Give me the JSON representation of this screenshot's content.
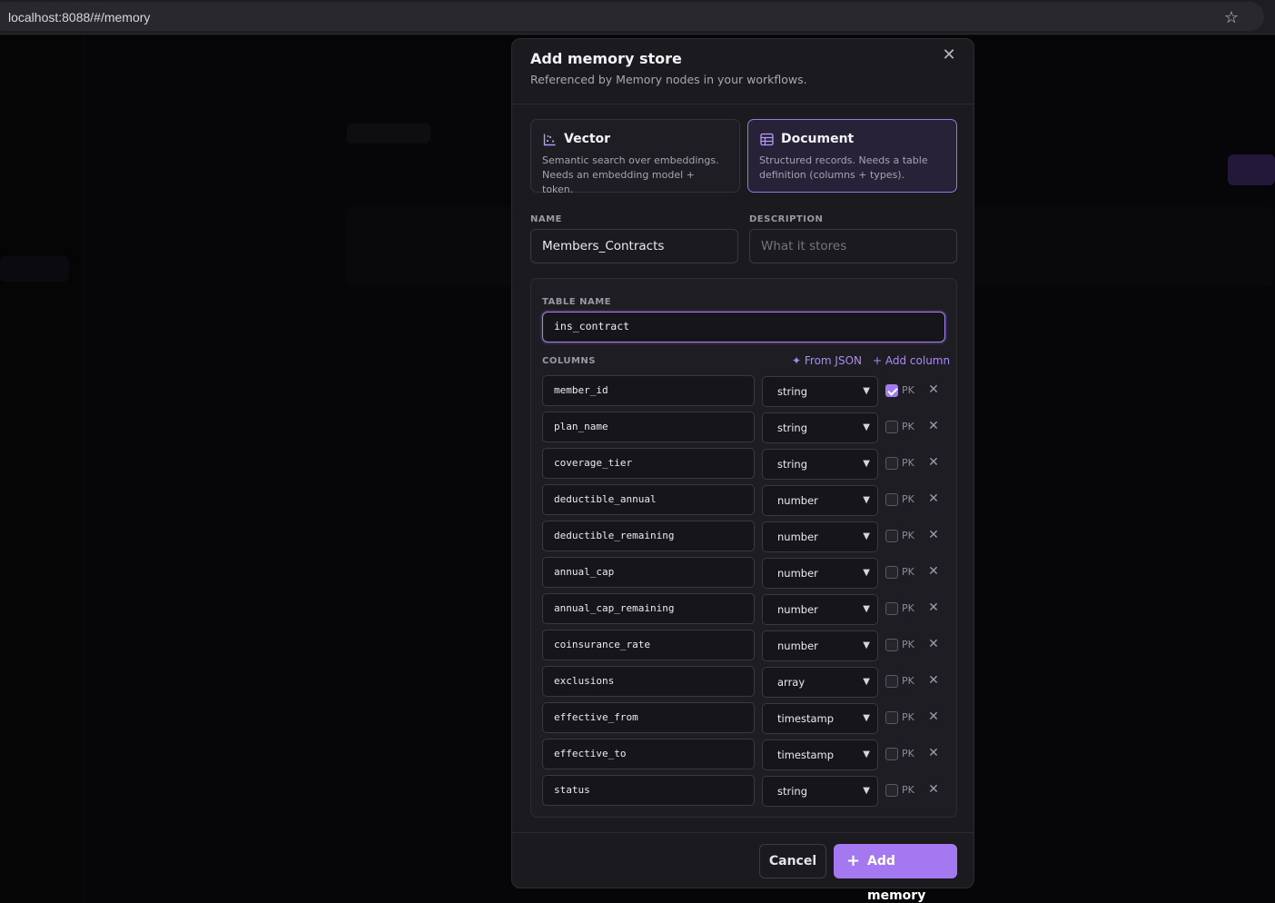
{
  "browser": {
    "url": "localhost:8088/#/memory"
  },
  "modal": {
    "title": "Add memory store",
    "subtitle": "Referenced by Memory nodes in your workflows.",
    "types": [
      {
        "title": "Vector",
        "desc": "Semantic search over embeddings. Needs an embedding model + token.",
        "selected": false,
        "icon": "scatter-chart-icon"
      },
      {
        "title": "Document",
        "desc": "Structured records. Needs a table definition (columns + types).",
        "selected": true,
        "icon": "table-icon"
      }
    ],
    "name_label": "NAME",
    "name_value": "Members_Contracts",
    "description_label": "DESCRIPTION",
    "description_placeholder": "What it stores",
    "table_name_label": "TABLE NAME",
    "table_name_value": "ins_contract",
    "columns_label": "COLUMNS",
    "from_json_label": "✦ From JSON",
    "add_column_label": "+ Add column",
    "pk_label": "PK",
    "columns": [
      {
        "name": "member_id",
        "type": "string",
        "pk": true
      },
      {
        "name": "plan_name",
        "type": "string",
        "pk": false
      },
      {
        "name": "coverage_tier",
        "type": "string",
        "pk": false
      },
      {
        "name": "deductible_annual",
        "type": "number",
        "pk": false
      },
      {
        "name": "deductible_remaining",
        "type": "number",
        "pk": false
      },
      {
        "name": "annual_cap",
        "type": "number",
        "pk": false
      },
      {
        "name": "annual_cap_remaining",
        "type": "number",
        "pk": false
      },
      {
        "name": "coinsurance_rate",
        "type": "number",
        "pk": false
      },
      {
        "name": "exclusions",
        "type": "array",
        "pk": false
      },
      {
        "name": "effective_from",
        "type": "timestamp",
        "pk": false
      },
      {
        "name": "effective_to",
        "type": "timestamp",
        "pk": false
      },
      {
        "name": "status",
        "type": "string",
        "pk": false
      }
    ],
    "cancel_label": "Cancel",
    "add_label": "Add memory"
  },
  "colors": {
    "accent": "#a478f0",
    "selected_card_border": "#9b74e8"
  }
}
